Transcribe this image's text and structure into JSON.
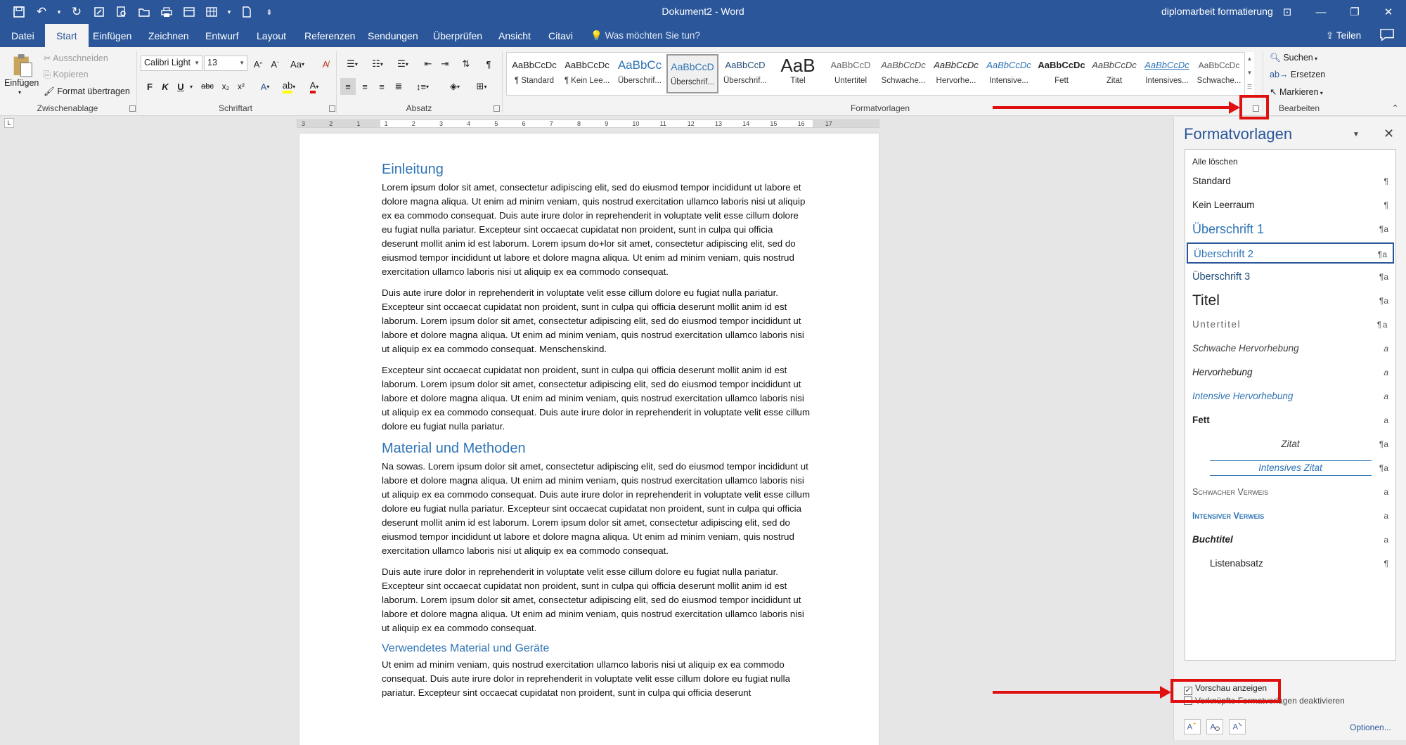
{
  "title_bar": {
    "document": "Dokument2 - Word",
    "user": "diplomarbeit formatierung"
  },
  "tabs": [
    "Datei",
    "Start",
    "Einfügen",
    "Zeichnen",
    "Entwurf",
    "Layout",
    "Referenzen",
    "Sendungen",
    "Überprüfen",
    "Ansicht",
    "Citavi"
  ],
  "active_tab": "Start",
  "tell_me": "Was möchten Sie tun?",
  "share": "Teilen",
  "clipboard": {
    "paste": "Einfügen",
    "cut": "Ausschneiden",
    "copy": "Kopieren",
    "format_painter": "Format übertragen",
    "label": "Zwischenablage"
  },
  "font": {
    "name": "Calibri Light",
    "size": "13",
    "label": "Schriftart",
    "bold": "F",
    "italic": "K",
    "underline": "U",
    "strike": "abc",
    "sub": "x₂",
    "sup": "x²",
    "case": "Aa"
  },
  "paragraph": {
    "label": "Absatz"
  },
  "styles_group": {
    "label": "Formatvorlagen",
    "items": [
      {
        "preview": "AaBbCcDc",
        "name": "¶ Standard"
      },
      {
        "preview": "AaBbCcDc",
        "name": "¶ Kein Lee..."
      },
      {
        "preview": "AaBbCc",
        "name": "Überschrif..."
      },
      {
        "preview": "AaBbCcD",
        "name": "Überschrif..."
      },
      {
        "preview": "AaBbCcD",
        "name": "Überschrif..."
      },
      {
        "preview": "AaB",
        "name": "Titel"
      },
      {
        "preview": "AaBbCcD",
        "name": "Untertitel"
      },
      {
        "preview": "AaBbCcDc",
        "name": "Schwache..."
      },
      {
        "preview": "AaBbCcDc",
        "name": "Hervorhe..."
      },
      {
        "preview": "AaBbCcDc",
        "name": "Intensive..."
      },
      {
        "preview": "AaBbCcDc",
        "name": "Fett"
      },
      {
        "preview": "AaBbCcDc",
        "name": "Zitat"
      },
      {
        "preview": "AaBbCcDc",
        "name": "Intensives..."
      },
      {
        "preview": "AaBbCcDc",
        "name": "Schwache..."
      }
    ]
  },
  "editing": {
    "find": "Suchen",
    "replace": "Ersetzen",
    "select": "Markieren",
    "label": "Bearbeiten"
  },
  "ruler": [
    "3",
    "2",
    "1",
    "1",
    "2",
    "3",
    "4",
    "5",
    "6",
    "7",
    "8",
    "9",
    "10",
    "11",
    "12",
    "13",
    "14",
    "15",
    "16",
    "17"
  ],
  "document": {
    "h_intro": "Einleitung",
    "p1": "Lorem ipsum dolor sit amet, consectetur adipiscing elit, sed do eiusmod tempor incididunt ut labore et dolore magna aliqua. Ut enim ad minim veniam, quis nostrud exercitation ullamco laboris nisi ut aliquip ex ea commodo consequat. Duis aute irure dolor in reprehenderit in voluptate velit esse cillum dolore eu fugiat nulla pariatur. Excepteur sint occaecat cupidatat non proident, sunt in culpa qui officia deserunt mollit anim id est laborum. Lorem ipsum do+lor sit amet, consectetur adipiscing elit, sed do eiusmod tempor incididunt ut labore et dolore magna aliqua. Ut enim ad minim veniam, quis nostrud exercitation ullamco laboris nisi ut aliquip ex ea commodo consequat.",
    "p2": "Duis aute irure dolor in reprehenderit in voluptate velit esse cillum dolore eu fugiat nulla pariatur. Excepteur sint occaecat cupidatat non proident, sunt in culpa qui officia deserunt mollit anim id est laborum. Lorem ipsum dolor sit amet, consectetur adipiscing elit, sed do eiusmod tempor incididunt ut labore et dolore magna aliqua. Ut enim ad minim veniam, quis nostrud exercitation ullamco laboris nisi ut aliquip ex ea commodo consequat. Menschenskind.",
    "p3": "Excepteur sint occaecat cupidatat non proident, sunt in culpa qui officia deserunt mollit anim id est laborum. Lorem ipsum dolor sit amet, consectetur adipiscing elit, sed do eiusmod tempor incididunt ut labore et dolore magna aliqua. Ut enim ad minim veniam, quis nostrud exercitation ullamco laboris nisi ut aliquip ex ea commodo consequat. Duis aute irure dolor in reprehenderit in voluptate velit esse cillum dolore eu fugiat nulla pariatur.",
    "h_methods": "Material und Methoden",
    "p4": "Na sowas. Lorem ipsum dolor sit amet, consectetur adipiscing elit, sed do eiusmod tempor incididunt ut labore et dolore magna aliqua. Ut enim ad minim veniam, quis nostrud exercitation ullamco laboris nisi ut aliquip ex ea commodo consequat. Duis aute irure dolor in reprehenderit in voluptate velit esse cillum dolore eu fugiat nulla pariatur. Excepteur sint occaecat cupidatat non proident, sunt in culpa qui officia deserunt mollit anim id est laborum. Lorem ipsum dolor sit amet, consectetur adipiscing elit, sed do eiusmod tempor incididunt ut labore et dolore magna aliqua. Ut enim ad minim veniam, quis nostrud exercitation ullamco laboris nisi ut aliquip ex ea commodo consequat.",
    "p5": "Duis aute irure dolor in reprehenderit in voluptate velit esse cillum dolore eu fugiat nulla pariatur. Excepteur sint occaecat cupidatat non proident, sunt in culpa qui officia deserunt mollit anim id est laborum. Lorem ipsum dolor sit amet, consectetur adipiscing elit, sed do eiusmod tempor incididunt ut labore et dolore magna aliqua. Ut enim ad minim veniam, quis nostrud exercitation ullamco laboris nisi ut aliquip ex ea commodo consequat.",
    "h_material": "Verwendetes Material und Geräte",
    "p6": "Ut enim ad minim veniam, quis nostrud exercitation ullamco laboris nisi ut aliquip ex ea commodo consequat. Duis aute irure dolor in reprehenderit in voluptate velit esse cillum dolore eu fugiat nulla pariatur. Excepteur sint occaecat cupidatat non proident, sunt in culpa qui officia deserunt"
  },
  "styles_pane": {
    "title": "Formatvorlagen",
    "clear_all": "Alle löschen",
    "styles": [
      {
        "name": "Standard",
        "mark": "¶"
      },
      {
        "name": "Kein Leerraum",
        "mark": "¶"
      },
      {
        "name": "Überschrift 1",
        "mark": "¶a"
      },
      {
        "name": "Überschrift 2",
        "mark": "¶a"
      },
      {
        "name": "Überschrift 3",
        "mark": "¶a"
      },
      {
        "name": "Titel",
        "mark": "¶a"
      },
      {
        "name": "Untertitel",
        "mark": "¶a"
      },
      {
        "name": "Schwache Hervorhebung",
        "mark": "a"
      },
      {
        "name": "Hervorhebung",
        "mark": "a"
      },
      {
        "name": "Intensive Hervorhebung",
        "mark": "a"
      },
      {
        "name": "Fett",
        "mark": "a"
      },
      {
        "name": "Zitat",
        "mark": "¶a"
      },
      {
        "name": "Intensives Zitat",
        "mark": "¶a"
      },
      {
        "name": "Schwacher Verweis",
        "mark": "a"
      },
      {
        "name": "Intensiver Verweis",
        "mark": "a"
      },
      {
        "name": "Buchtitel",
        "mark": "a"
      },
      {
        "name": "Listenabsatz",
        "mark": "¶"
      }
    ],
    "selected_style": "Überschrift 2",
    "show_preview": "Vorschau anzeigen",
    "show_preview_checked": true,
    "disable_linked": "Verknüpfte Formatvorlagen deaktivieren",
    "options": "Optionen..."
  },
  "colors": {
    "accent": "#2b579a",
    "heading": "#2e74b5",
    "annotation": "#e01010"
  }
}
